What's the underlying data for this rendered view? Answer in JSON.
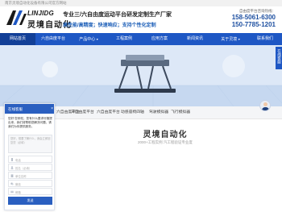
{
  "topbar": {
    "text": "南京灵境自动化设备有限公司官方网站"
  },
  "logo": {
    "en": "LINJIDG",
    "cn": "灵境自动化"
  },
  "slogan": {
    "line1": "专业三/六自由度运动平台研发定制生产厂家",
    "line2": "高性能/高精度；快速响应；支持个性化定制"
  },
  "hotline": {
    "label": "自由度平台咨询热线：",
    "phone1": "158-5061-6300",
    "phone2": "150-7785-1201"
  },
  "nav": {
    "items": [
      {
        "label": "网站首页"
      },
      {
        "label": "六自由度平台"
      },
      {
        "label": "产品中心"
      },
      {
        "label": "工程案例"
      },
      {
        "label": "应用方案"
      },
      {
        "label": "新闻资讯"
      },
      {
        "label": "关于灵境"
      },
      {
        "label": "联系我们"
      }
    ]
  },
  "subnav": {
    "items": [
      {
        "label": "六自由度平台"
      },
      {
        "label": "三自由度平台"
      },
      {
        "label": "六自由度平台"
      },
      {
        "label": "动感座椅四轴"
      },
      {
        "label": "驾驶模拟器"
      },
      {
        "label": "飞行模拟器"
      }
    ]
  },
  "side_float": {
    "label": "在线客服"
  },
  "hero": {
    "title": "灵境自动化",
    "subtitle": "2000+工程实例 汽工程验证专业度"
  },
  "chat": {
    "title": "在线客服",
    "close": "×",
    "message": "您好 您来啦，您有什么要求尽管提出来，我们将帮助您解决问题，请我们为你提供服务。",
    "textarea_placeholder": "您好，想要了解什么，我会立即回复您（必填）",
    "fields": [
      {
        "placeholder": "电话",
        "icon": "phone-icon"
      },
      {
        "placeholder": "姓名（必填）",
        "icon": "user-icon"
      },
      {
        "placeholder": "单位名称",
        "icon": "building-icon"
      },
      {
        "placeholder": "微信",
        "icon": "wechat-icon"
      },
      {
        "placeholder": "邮箱",
        "icon": "mail-icon"
      }
    ],
    "send": "发送"
  },
  "colors": {
    "brand": "#1e57c4",
    "brand_dark": "#123f97",
    "accent_text": "#1d5fb8"
  }
}
